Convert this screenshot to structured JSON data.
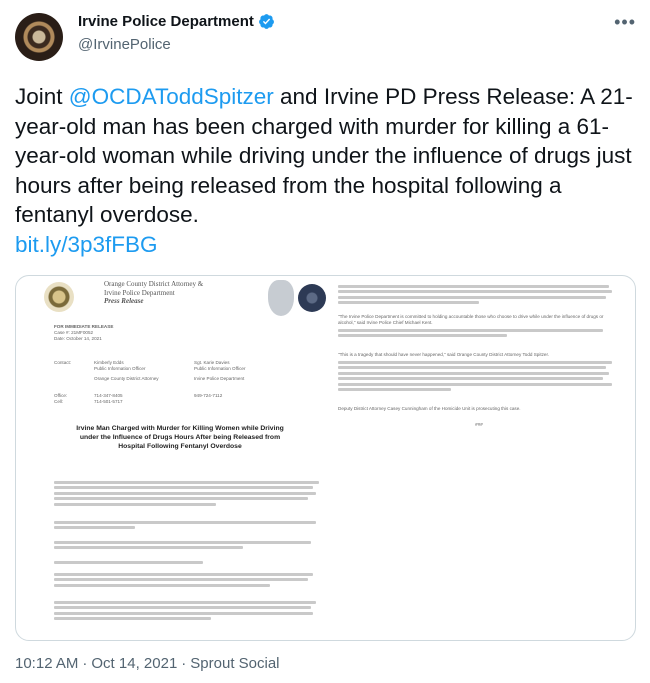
{
  "author": {
    "display_name": "Irvine Police Department",
    "handle": "@IrvinePolice"
  },
  "tweet": {
    "text_before": "Joint ",
    "mention": "@OCDATodd​Spitzer",
    "text_after": " and Irvine PD Press Release: A 21-year-old man has been charged with murder for killing a 61-year-old woman while driving under the influence of drugs just hours after being released from the hospital following a fentanyl overdose.",
    "link": "bit.ly/3p3fFBG"
  },
  "document": {
    "office_line1": "Orange County District Attorney &",
    "office_line2": "Irvine Police Department",
    "release_label": "Press Release",
    "immediate_label": "FOR IMMEDIATE RELEASE",
    "case_no": "Case #: 21MF0052",
    "date": "Date: October 14, 2021",
    "contacts_label": "Contact:",
    "contact_left_name": "Kimberly Edds",
    "contact_left_title": "Public Information Officer",
    "contact_left_org": "Orange County District Attorney",
    "contact_right_name": "Sgt. Karie Davies",
    "contact_right_title": "Public Information Officer",
    "contact_right_org": "Irvine Police Department",
    "office_label": "Office:",
    "cell_label": "Cell:",
    "office_left": "714-347-8405",
    "cell_left": "714-501-5717",
    "office_right": "949-724-7112",
    "headline": "Irvine Man Charged with Murder for Killing Women while Driving under the Influence of Drugs Hours After being Released from Hospital Following Fentanyl Overdose",
    "right_quote_1": "\"The Irvine Police Department is committed to holding accountable those who choose to drive while under the influence of drugs or alcohol,\" said Irvine Police Chief Michael Kent.",
    "right_quote_2": "\"This is a tragedy that should have never happened,\" said Orange County District Attorney Todd Spitzer.",
    "right_closing": "Deputy District Attorney Casey Cunningham of the Homicide Unit is prosecuting this case.",
    "end_mark": "###"
  },
  "footer": {
    "time": "10:12 AM",
    "dot1": "·",
    "date": "Oct 14, 2021",
    "dot2": "·",
    "source": "Sprout Social"
  },
  "colors": {
    "link": "#1d9bf0",
    "verified": "#1d9bf0",
    "muted": "#536471"
  }
}
